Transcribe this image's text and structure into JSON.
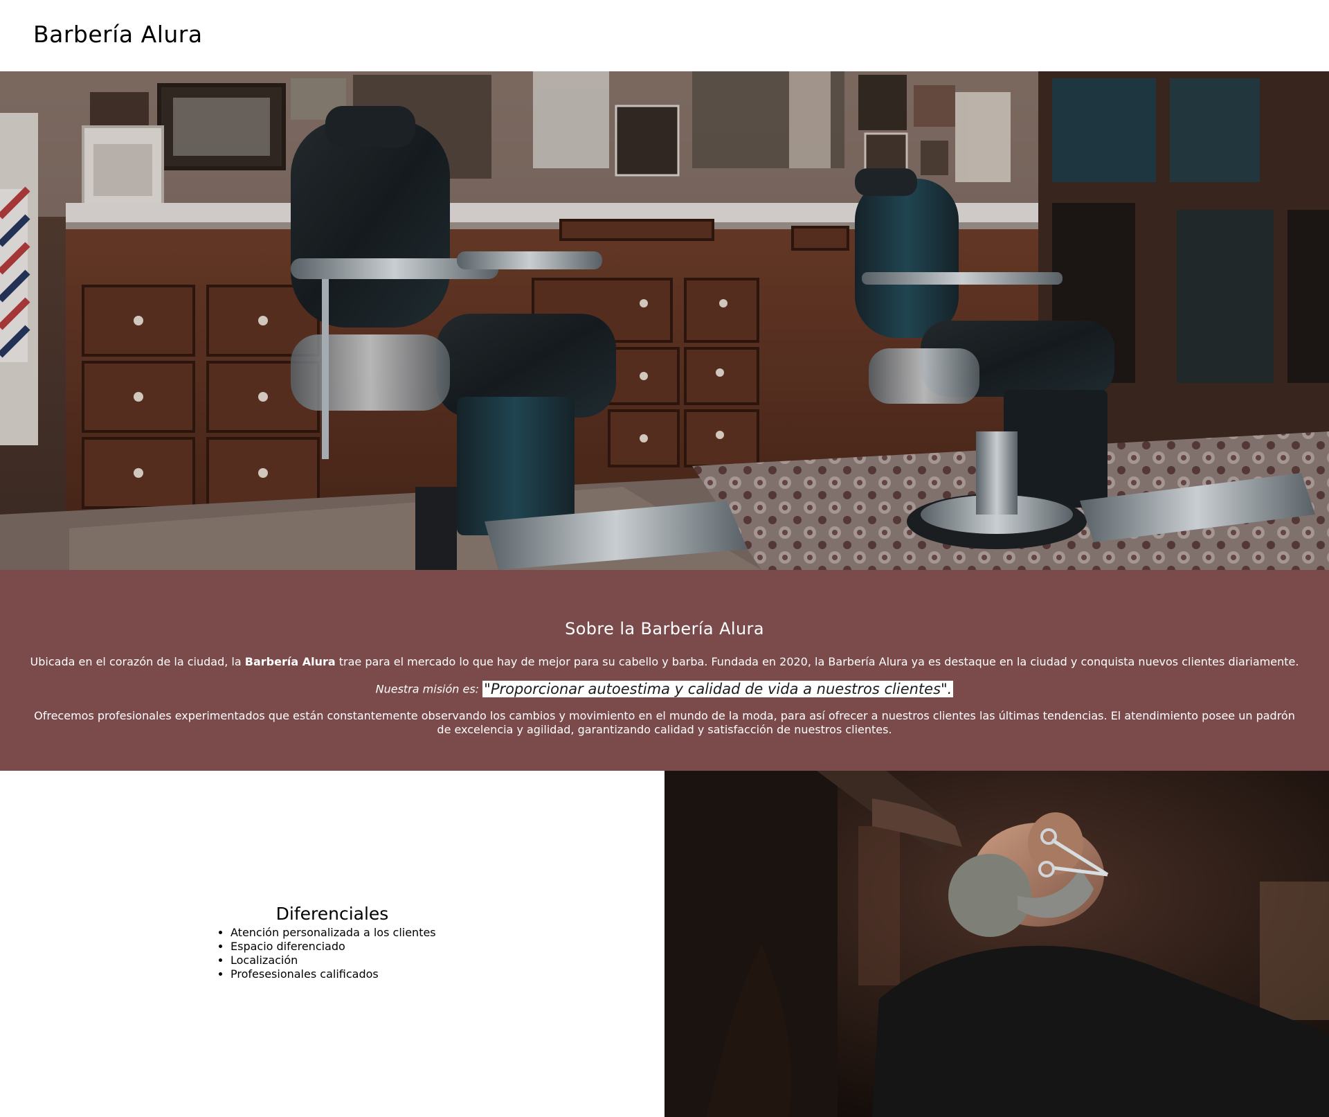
{
  "header": {
    "title": "Barbería Alura"
  },
  "about": {
    "heading": "Sobre la Barbería Alura",
    "intro_before": "Ubicada en el corazón de la ciudad, la ",
    "intro_bold": "Barbería Alura",
    "intro_after": " trae para el mercado lo que hay de mejor para su cabello y barba. Fundada en 2020, la Barbería Alura ya es destaque en la ciudad y conquista nuevos clientes diariamente.",
    "mission_label": "Nuestra misión es:",
    "mission_quote": "\"Proporcionar autoestima y calidad de vida a nuestros clientes\".",
    "services_text": "Ofrecemos profesionales experimentados que están constantemente observando los cambios y movimiento en el mundo de la moda, para así ofrecer a nuestros clientes las últimas tendencias. El atendimiento posee un padrón de excelencia y agilidad, garantizando calidad y satisfacción de nuestros clientes."
  },
  "features": {
    "heading": "Diferenciales",
    "items": [
      "Atención personalizada a los clientes",
      "Espacio diferenciado",
      "Localización",
      "Profesesionales calificados"
    ]
  },
  "colors": {
    "about_background": "#7b4a4b",
    "header_background": "#ffffff"
  }
}
